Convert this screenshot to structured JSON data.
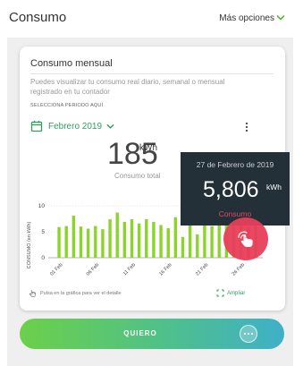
{
  "header": {
    "title": "Consumo",
    "options_label": "Más opciones"
  },
  "card": {
    "title": "Consumo mensual",
    "description": "Puedes visualizar tu consumo real diario, semanal o mensual registrado en tu contador",
    "period_label": "SELECCIONA PERIODO AQUÍ",
    "period_value": "Febrero 2019",
    "total_value": "185",
    "total_unit": "kWh",
    "total_label": "Consumo total",
    "hint": "Pulsa en la gráfica para ver el detalle",
    "expand_label": "Ampliar"
  },
  "tooltip": {
    "date": "27 de Febrero de 2019",
    "value": "5,806",
    "unit": "kWh",
    "label": "Consumo"
  },
  "cta": {
    "label": "QUIERO"
  },
  "colors": {
    "accent": "#2e9e63",
    "bar": "#8bd42b",
    "tooltip_bg": "#243038",
    "highlight": "#e83e5a"
  },
  "chart_data": {
    "type": "bar",
    "ylabel": "CONSUMO (en kWh)",
    "ylim": [
      0,
      10
    ],
    "yticks": [
      0,
      5,
      10
    ],
    "x_tick_labels": [
      "01 Feb",
      "06 Feb",
      "11 Feb",
      "16 Feb",
      "21 Feb",
      "26 Feb"
    ],
    "x_tick_index": [
      0,
      5,
      10,
      15,
      20,
      25
    ],
    "categories": [
      "01 Feb",
      "02 Feb",
      "03 Feb",
      "04 Feb",
      "05 Feb",
      "06 Feb",
      "07 Feb",
      "08 Feb",
      "09 Feb",
      "10 Feb",
      "11 Feb",
      "12 Feb",
      "13 Feb",
      "14 Feb",
      "15 Feb",
      "16 Feb",
      "17 Feb",
      "18 Feb",
      "19 Feb",
      "20 Feb",
      "21 Feb",
      "22 Feb",
      "23 Feb",
      "24 Feb",
      "25 Feb",
      "26 Feb",
      "27 Feb",
      "28 Feb"
    ],
    "values": [
      5.9,
      6.1,
      8.1,
      6.0,
      5.6,
      6.1,
      5.5,
      7.4,
      8.7,
      6.9,
      7.4,
      6.6,
      7.4,
      6.9,
      6.3,
      5.7,
      7.8,
      4.0,
      7.4,
      4.5,
      6.8,
      6.1,
      6.3,
      6.8,
      6.3,
      7.2,
      5.8,
      8.0
    ],
    "highlight_index": 26
  }
}
